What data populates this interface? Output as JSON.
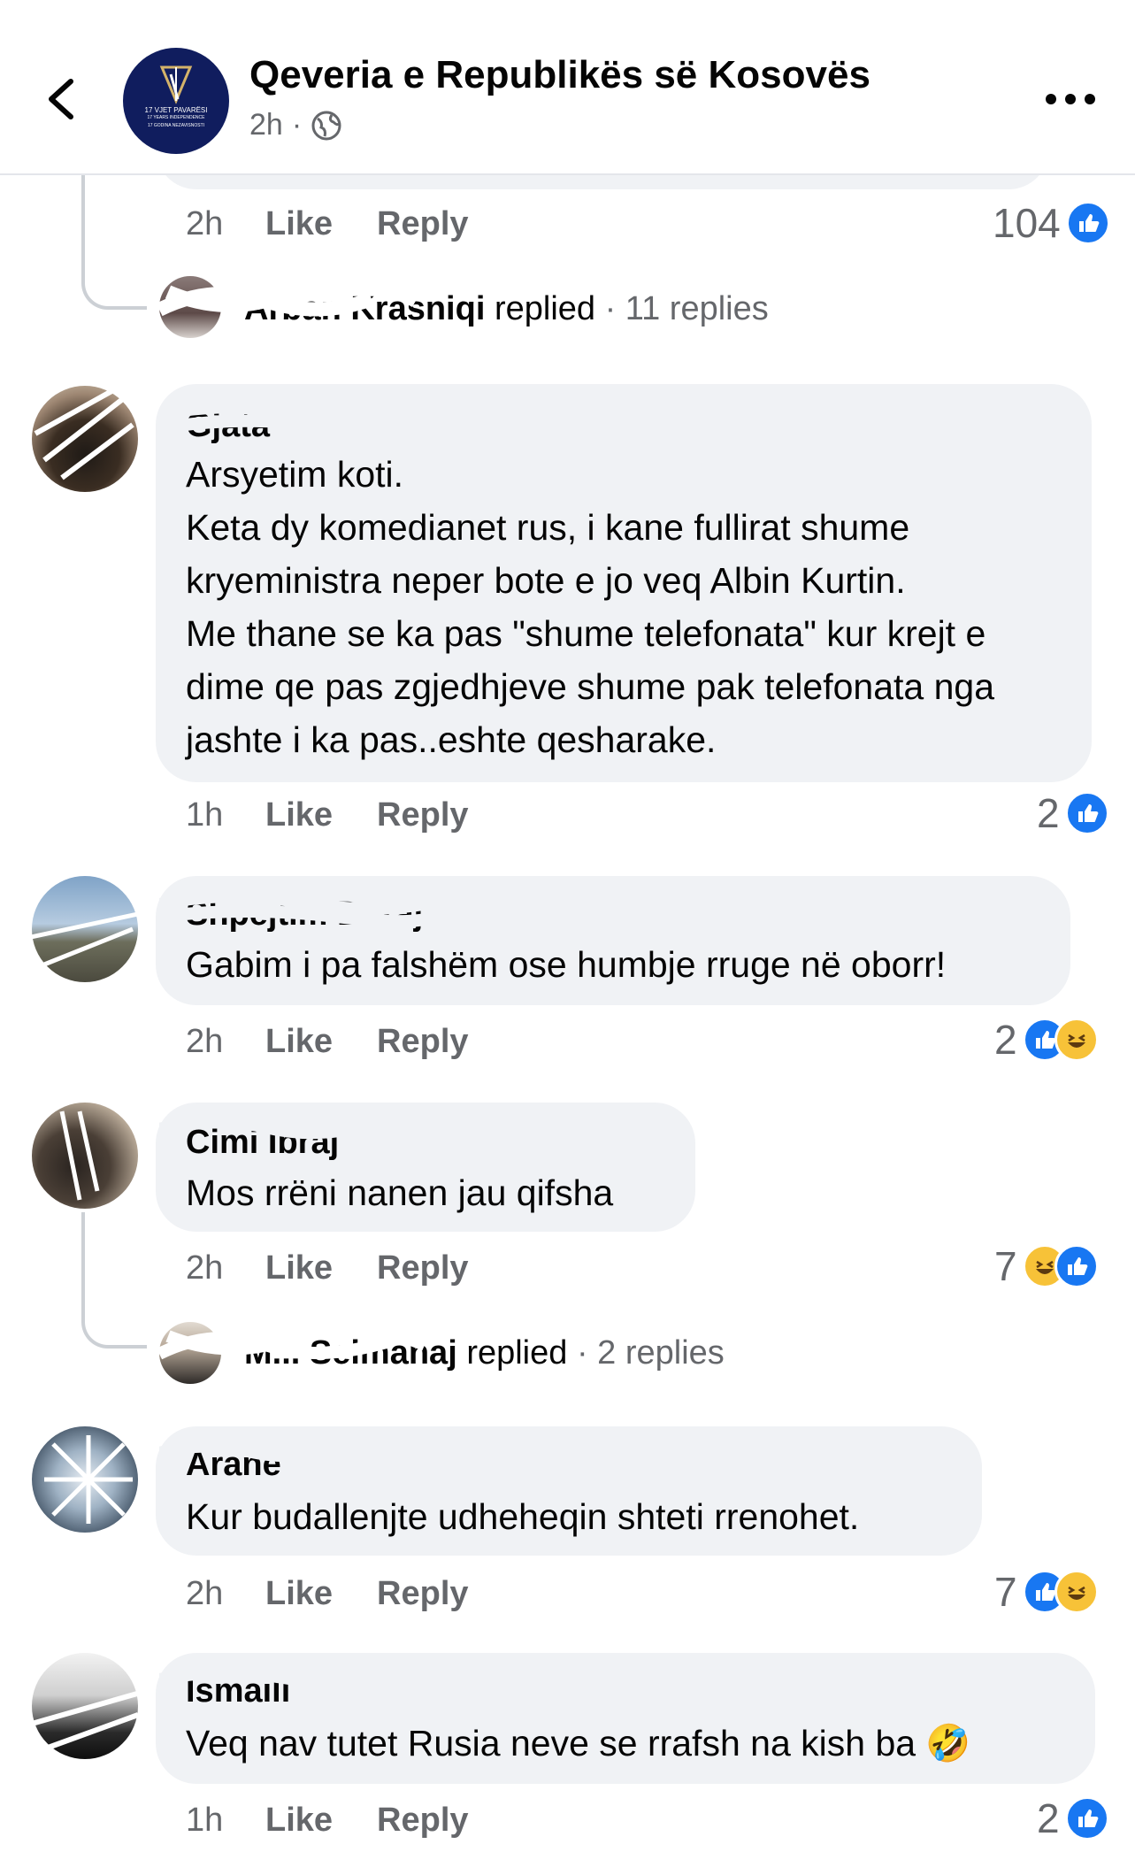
{
  "header": {
    "page_name": "Qeveria e Republikës së Kosovës",
    "time": "2h",
    "separator": "·",
    "avatar_text": "17 VJET PAVARËSI",
    "avatar_sub1": "17 YEARS INDEPENDENCE",
    "avatar_sub2": "17 GODINA NEZAVISNOSTI"
  },
  "top_comment": {
    "time": "2h",
    "like_label": "Like",
    "reply_label": "Reply",
    "reactions": "104",
    "replied_name": "Arban Krasniqi",
    "replied_word": "replied",
    "replies": "· 11 replies"
  },
  "comments": [
    {
      "author": "Gjata",
      "text": "Arsyetim koti.\nKeta dy komedianet rus, i kane fullirat shume kryeministra neper bote e jo veq Albin Kurtin.\nMe thane se ka pas \"shume telefonata\" kur krejt e dime qe pas zgjedhjeve shume pak telefonata nga jashte i ka pas..eshte qesharake.",
      "time": "1h",
      "like_label": "Like",
      "reply_label": "Reply",
      "reactions": "2"
    },
    {
      "author": "Shpejtim Duraj",
      "text": "Gabim i pa falshëm ose humbje rruge në oborr!",
      "time": "2h",
      "like_label": "Like",
      "reply_label": "Reply",
      "reactions": "2"
    },
    {
      "author": "Cimi Ibraj",
      "text": "Mos rrëni nanen jau qifsha",
      "time": "2h",
      "like_label": "Like",
      "reply_label": "Reply",
      "reactions": "7",
      "replied_name": "M... Selmanaj",
      "replied_word": "replied",
      "replies": "· 2 replies"
    },
    {
      "author": "Arane",
      "text": "Kur budallenjte udheheqin shteti rrenohet.",
      "time": "2h",
      "like_label": "Like",
      "reply_label": "Reply",
      "reactions": "7"
    },
    {
      "author": "Ismaili",
      "text": "Veq nav tutet Rusia neve se rrafsh na kish ba 🤣",
      "time": "1h",
      "like_label": "Like",
      "reply_label": "Reply",
      "reactions": "2"
    }
  ],
  "colors": {
    "like_blue": "#1877f2",
    "bubble": "#f0f2f5",
    "secondary_text": "#65676b"
  },
  "icons": [
    "back-arrow-icon",
    "globe-icon",
    "more-icon",
    "like-reaction-icon",
    "haha-reaction-icon",
    "rofl-emoji"
  ]
}
